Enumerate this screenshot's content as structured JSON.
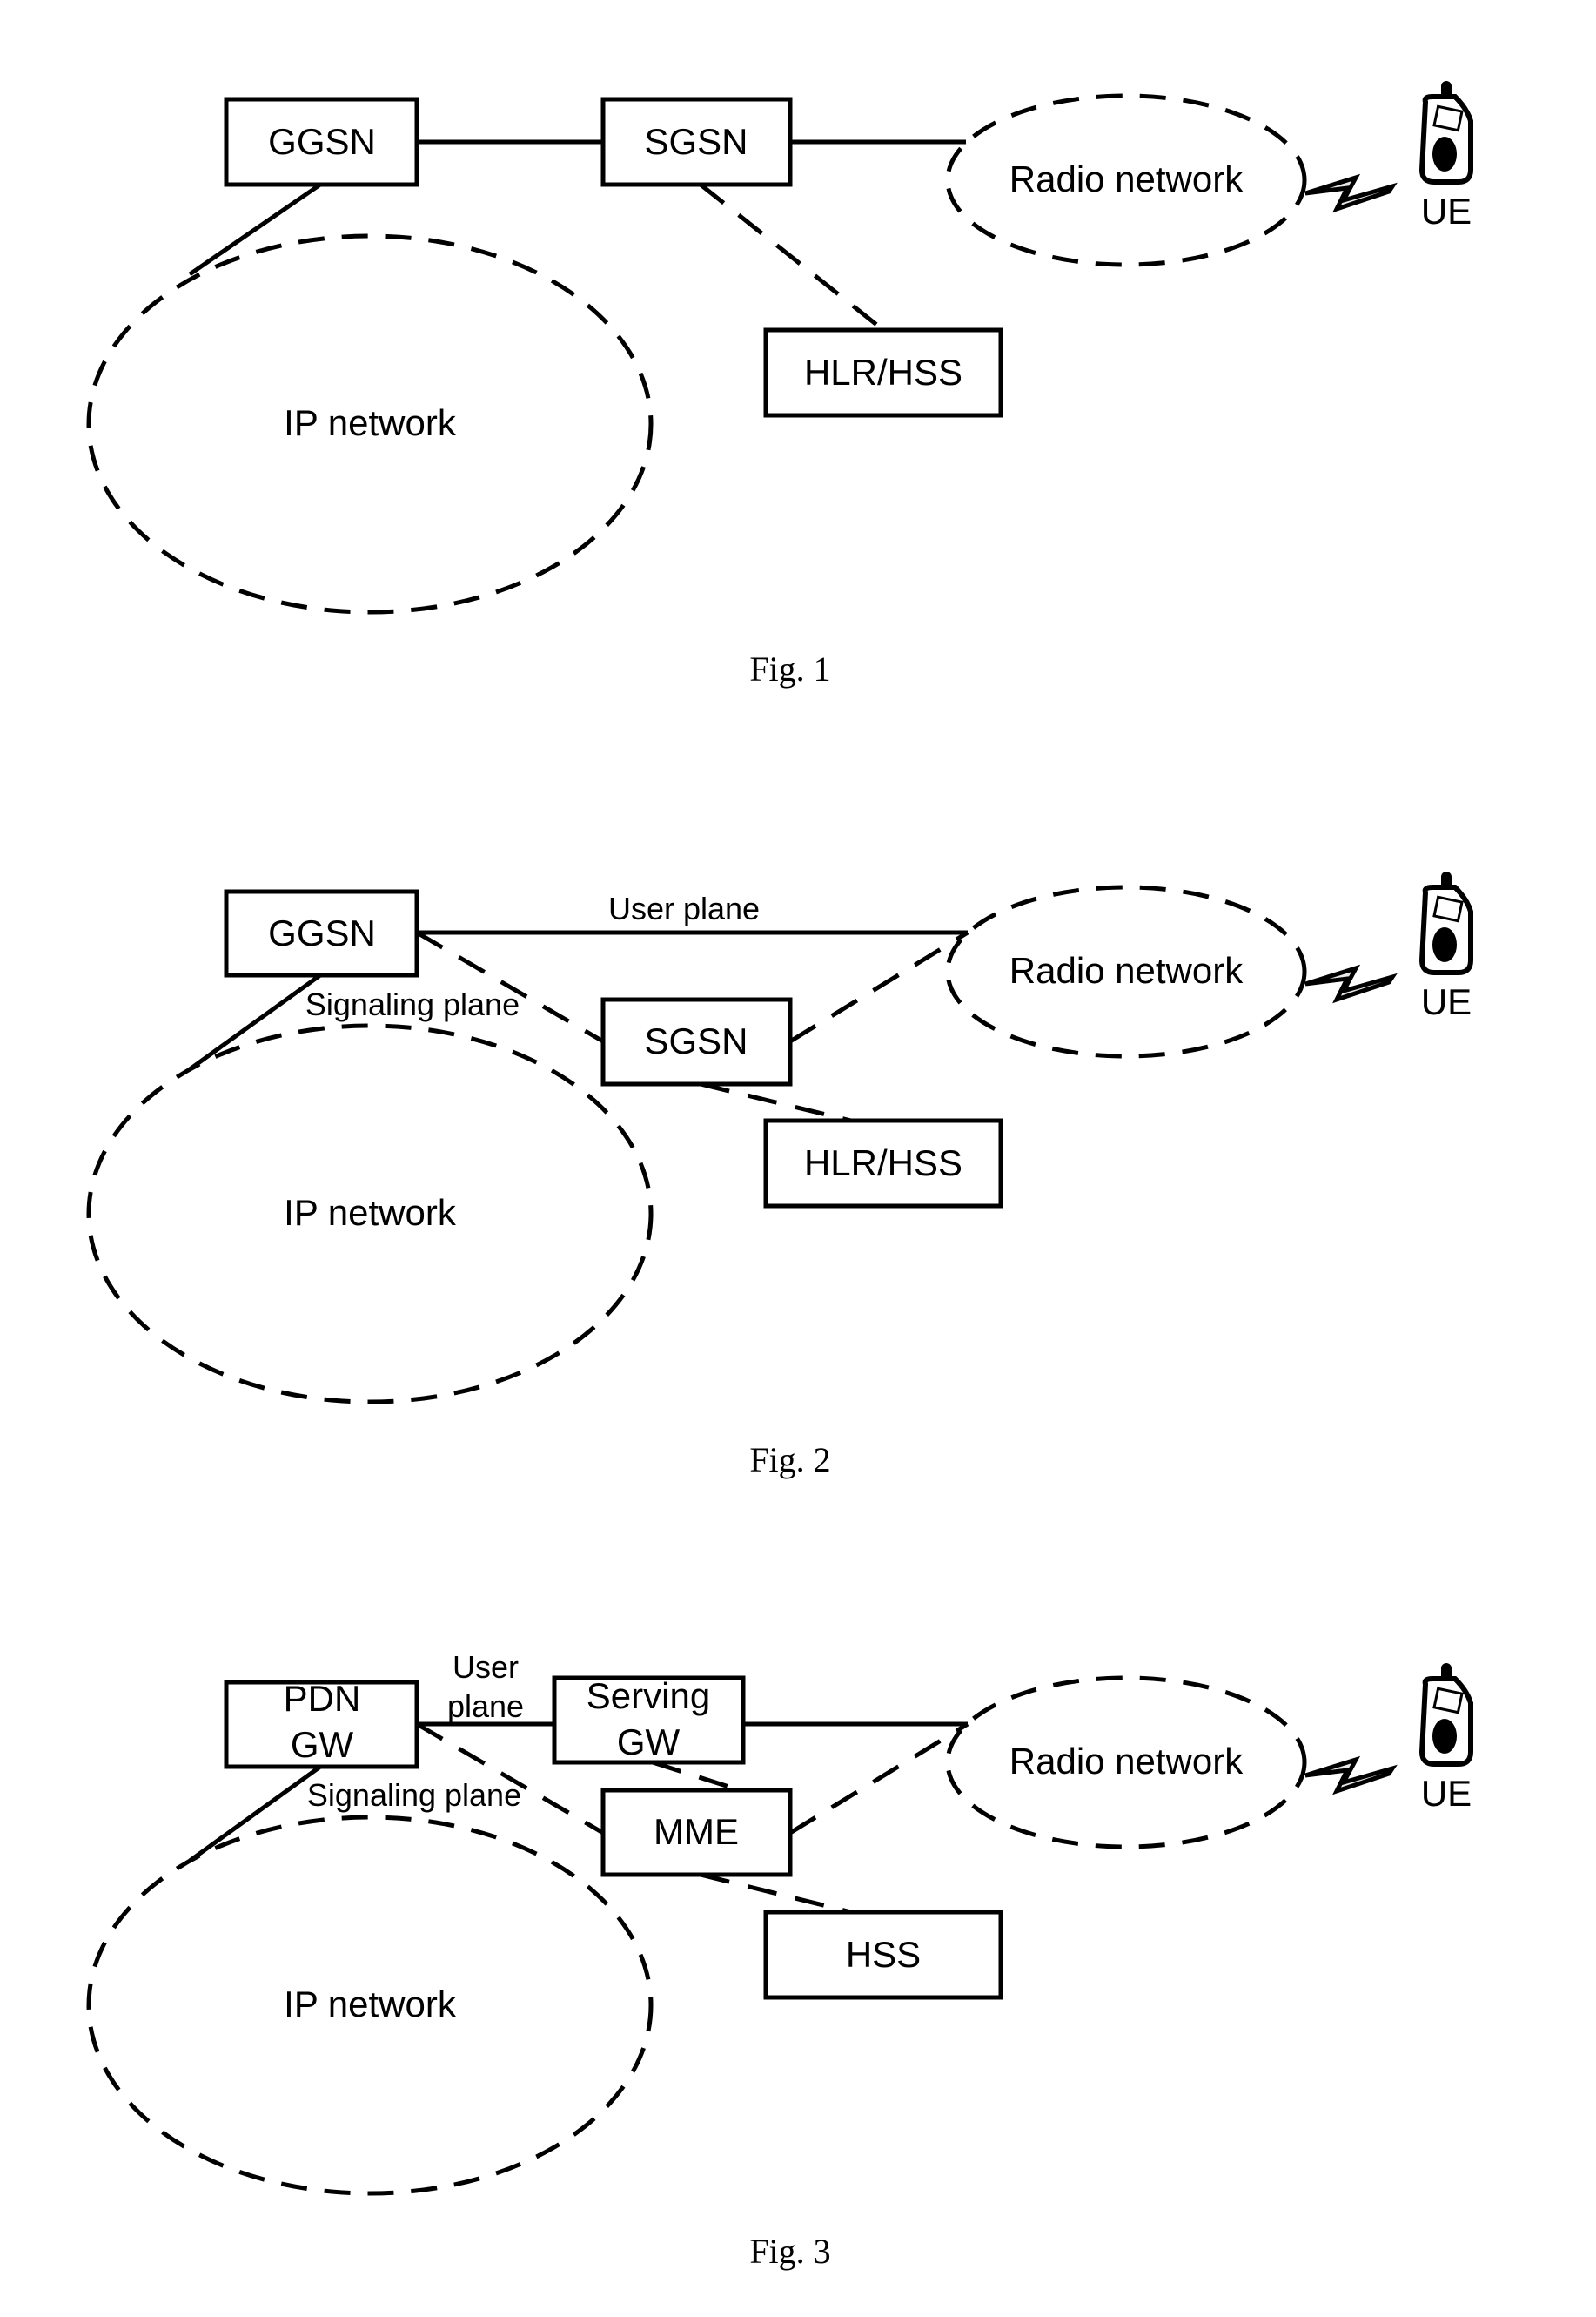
{
  "figures": [
    {
      "caption": "Fig. 1",
      "nodes": {
        "ggsn": "GGSN",
        "sgsn": "SGSN",
        "hlr": "HLR/HSS",
        "radio": "Radio network",
        "ip": "IP network",
        "ue": "UE"
      }
    },
    {
      "caption": "Fig. 2",
      "nodes": {
        "ggsn": "GGSN",
        "sgsn": "SGSN",
        "hlr": "HLR/HSS",
        "radio": "Radio network",
        "ip": "IP network",
        "ue": "UE"
      },
      "labels": {
        "user_plane": "User plane",
        "signaling_plane": "Signaling plane"
      }
    },
    {
      "caption": "Fig. 3",
      "nodes": {
        "pdn_line1": "PDN",
        "pdn_line2": "GW",
        "serving_line1": "Serving",
        "serving_line2": "GW",
        "mme": "MME",
        "hss": "HSS",
        "radio": "Radio network",
        "ip": "IP network",
        "ue": "UE"
      },
      "labels": {
        "user_line1": "User",
        "user_line2": "plane",
        "signaling_plane": "Signaling plane"
      }
    }
  ]
}
